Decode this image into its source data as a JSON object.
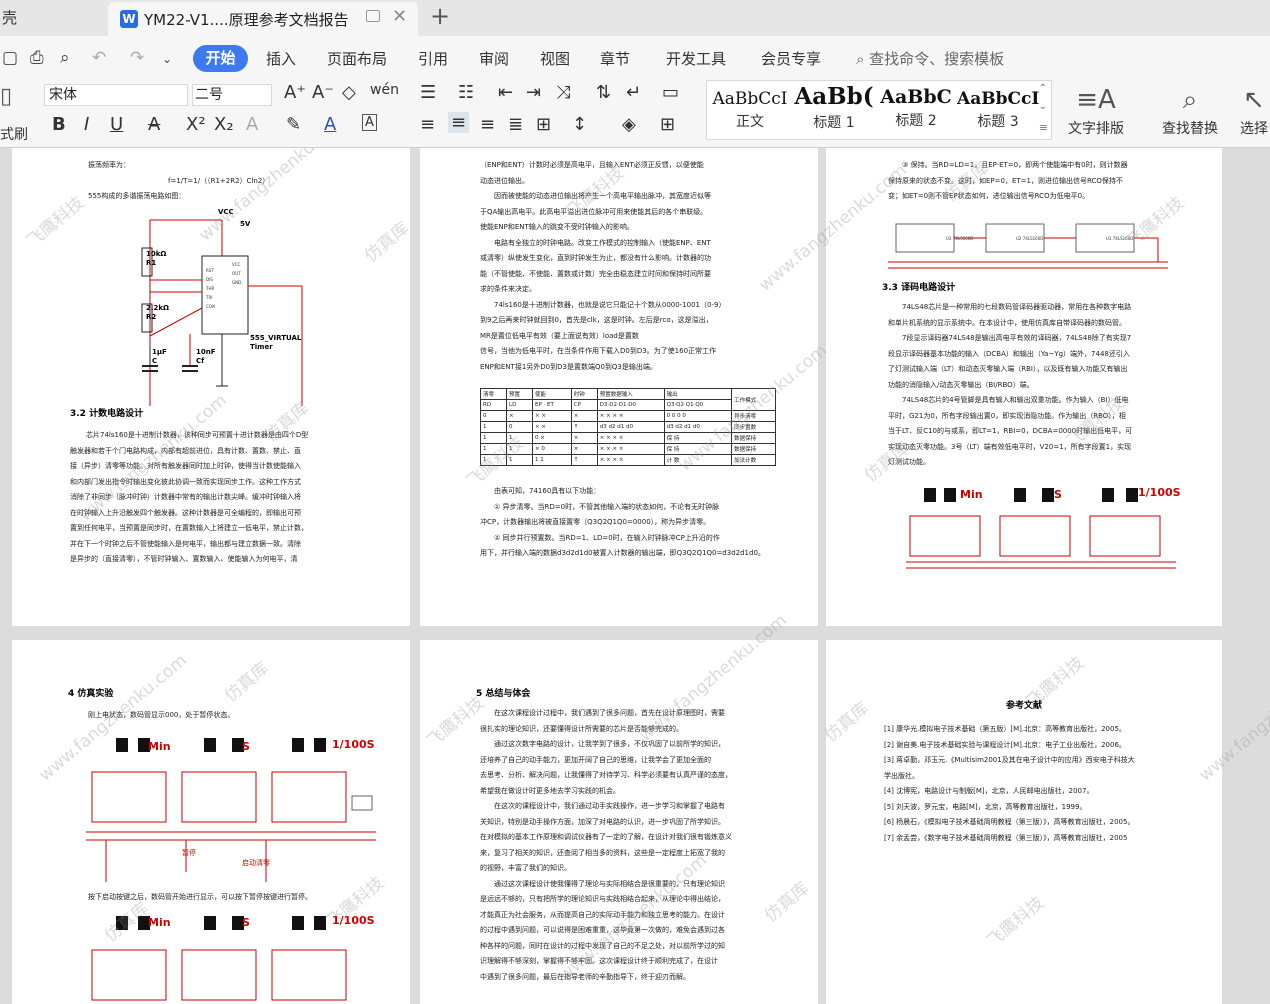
{
  "tabs": {
    "prev_label": "壳",
    "active_title": "YM22-V1....原理参考文档报告",
    "add": "+"
  },
  "menu": {
    "items": [
      "插入",
      "页面布局",
      "引用",
      "审阅",
      "视图",
      "章节",
      "开发工具",
      "会员专享"
    ],
    "active": "开始",
    "search_placeholder": "查找命令、搜索模板"
  },
  "toolbar": {
    "paste_label": "式刷",
    "font_name": "宋体",
    "font_size": "二号",
    "styles": [
      {
        "sample": "AaBbCcI",
        "name": "正文"
      },
      {
        "sample": "AaBb(",
        "name": "标题 1"
      },
      {
        "sample": "AaBbC",
        "name": "标题 2"
      },
      {
        "sample": "AaBbCcI",
        "name": "标题 3"
      }
    ],
    "text_layout": "文字排版",
    "find_replace": "查找替换",
    "select": "选择"
  },
  "page1": {
    "lines_top": [
      "振荡频率为：",
      "f=1/T=1/（（R1+2R2）Cln2）",
      "555构成的多谐振荡电路如图："
    ],
    "circuit": {
      "vcc": "VCC",
      "v5": "5V",
      "r1": "10kΩ",
      "r1n": "R1",
      "r2": "2.2kΩ",
      "r2n": "R2",
      "c": "1μF",
      "cn": "C",
      "cf": "10nF",
      "cfn": "Cf",
      "timer": "555_VIRTUAL",
      "timer2": "Timer",
      "pins": [
        "RST",
        "DIS",
        "THR",
        "TRI",
        "CON",
        "VCC",
        "OUT",
        "GND"
      ]
    },
    "heading": "3.2  计数电路设计",
    "body": [
      "芯片74ls160是十进制计数器，该种同步可预置十进计数器是由四个D型",
      "触发器和若干个门电路构成，内部有超前进位，具有计数、置数、禁止、直",
      "接（异步）清零等功能。对所有触发器同时加上时钟，使得当计数使能输入",
      "和内部门发出指令时输出变化彼此协调一致而实现同步工作。这种工作方式",
      "消除了非同步（脉冲时钟）计数器中常有的输出计数尖峰。缓冲时钟输入将",
      "在时钟输入上升沿触发四个触发器。这种计数器是可全编程的，即输出可预",
      "置到任何电平，当预置是同步时，在置数输入上将建立一低电平，禁止计数，",
      "并在下一个时钟之后不管使能输入是何电平，输出都与建立数据一致。清除",
      "是异步的（直接清零），不管时钟输入、置数输入、使能输入为何电平，清"
    ]
  },
  "page2": {
    "body": [
      "（ENP和ENT）计数时必须是高电平，且输入ENT必须正反馈，以便使能",
      "动态进位输出。",
      "因而被使能的动态进位输出将产生一个高电平输出脉冲，其宽度近似等",
      "于QA输出高电平。此高电平溢出进位脉冲可用来使能其后的各个串联级。",
      "使能ENP和ENT输入的跳变不受时钟输入的影响。",
      "电路有全独立的时钟电路。改变工作模式的控制输入（使能ENP、ENT",
      "或清零）纵使发生变化，直到时钟发生为止，都没有什么影响。计数器的功",
      "能（不管使能、不使能、置数或计数）完全由稳态建立时间和保持时间所要",
      "求的条件来决定。",
      "74ls160是十进制计数器，也就是说它只能记十个数从0000-1001（0-9）",
      "到9之后再来时钟就回到0，首先是clk，这是时钟。左后是rco，这是溢出，",
      "MR是置位低电平有效（要上面说有效）load是置数",
      "信号，当他为低电平时，在当条件作用下载入D0到D3。为了使160正常工作",
      "ENP和ENT接1另外D0到D3是置数端Q0到Q3是输出端。"
    ],
    "table_head": [
      "清零",
      "预置",
      "使能",
      "时钟",
      "预置数据输入",
      "输出",
      "工作模式"
    ],
    "table_sub": [
      "RD",
      "LD",
      "EP · ET",
      "CP",
      "D3·D2·D1·D0",
      "Q3·Q2·Q1·Q0",
      ""
    ],
    "table_rows": [
      [
        "0",
        "×",
        "× ×",
        "×",
        "× × × ×",
        "0 0 0 0",
        "异步清零"
      ],
      [
        "1",
        "0",
        "× ×",
        "↑",
        "d3 d2 d1 d0",
        "d3 d2 d1 d0",
        "同步置数"
      ],
      [
        "1",
        "1",
        "0 ×",
        "×",
        "× × × ×",
        "保 持",
        "数据保持"
      ],
      [
        "1",
        "1",
        "× 0",
        "×",
        "× × × ×",
        "保 持",
        "数据保持"
      ],
      [
        "1",
        "1",
        "1 1",
        "↑",
        "× × × ×",
        "计 数",
        "加法计数"
      ]
    ],
    "after": [
      "由表可知，74160具有以下功能：",
      "① 异步清零。当RD=0时，不管其他输入端的状态如何，不论有无时钟脉",
      "冲CP，计数器输出将被直接置零（Q3Q2Q1Q0=0000），称为异步清零。",
      "② 同步并行预置数。当RD=1、LD=0时，在输入时钟脉冲CP上升沿的作",
      "用下，并行输入端的数据d3d2d1d0被置入计数器的输出端，即Q3Q2Q1Q0=d3d2d1d0。"
    ]
  },
  "page3": {
    "top": [
      "③ 保持。当RD=LD=1，且EP·ET=0，即两个使能端中有0时，则计数器",
      "保持原来的状态不变。这时，如EP=0，ET=1，则进位输出信号RCO保持不",
      "变；如ET=0则不管EP状态如何，进位输出信号RCO为低电平0。"
    ],
    "chips": [
      "U3 74LS160D",
      "U2 74LS160D",
      "U1 74LS160D"
    ],
    "heading": "3.3  译码电路设计",
    "body": [
      "74LS48芯片是一种常用的七段数码管译码器驱动器，常用在各种数字电路",
      "和单片机系统的显示系统中。在本设计中，使用仿真库自带译码器的数码管。",
      "7段显示译码器74LS48是输出高电平有效的译码器，74LS48除了有实现7",
      "段显示译码器基本功能的输入（DCBA）和输出（Ya~Yg）端外，7448还引入",
      "了灯测试输入端（LT）和动态灭零输入端（RBI），以及既有输入功能又有输出",
      "功能的消隐输入/动态灭零输出（BI/RBO）端。",
      "74LS48芯片的4号管脚是具有输入和输出双重功能。作为输入（BI）低电",
      "平时，G21为0，所有字段输出置0，即实现消隐功能。作为输出（RBO），相",
      "当于LT、反C10的与或系，即LT=1，RBI=0，DCBA=0000时输出低电平，可",
      "实现动态灭零功能。3号（LT）端有效低电平时，V20=1，所有字段置1，实现",
      "灯测试功能。"
    ],
    "labels": [
      "Min",
      "S",
      "1/100S"
    ]
  },
  "page4": {
    "heading": "4  仿真实验",
    "line1": "刚上电状态，数码管显示000，处于暂停状态。",
    "line2": "按下启动按键之后，数码管开始进行显示，可以按下暂停按键进行暂停。",
    "labels": [
      "Min",
      "S",
      "1/100S"
    ],
    "sub_labels": [
      "暂停",
      "启动清零"
    ]
  },
  "page5": {
    "heading": "5  总结与体会",
    "body": [
      "在这次课程设计过程中，我们遇到了很多问题，首先在设计原理图时，需要",
      "很扎实的理论知识，还要懂得设计所需要的芯片是否能够完成的。",
      "通过这次数字电路的设计，让我学到了很多，不仅巩固了以前所学的知识，",
      "还培养了自己的动手能力，更加开阔了自己的思维，让我学会了更加全面的",
      "去思考、分析、解决问题，让我懂得了对待学习、科学必须要有认真严谨的态度，",
      "希望我在做设计时更多地去学习实践的机会。",
      "在这次的课程设计中，我们通过动手实践操作，进一步学习和掌握了电路有",
      "关知识，特别是动手操作方面，加深了对电路的认识，进一步巩固了所学知识。",
      "在对模拟的基本工作原理和调试仪器有了一定的了解，在设计对我们很有锻炼意义",
      "来，复习了相关的知识，还查阅了相当多的资料，这些是一定程度上拓宽了我的",
      "的视野，丰富了我们的知识。",
      "通过这次课程设计使我懂得了理论与实际相结合是很重要的，只有理论知识",
      "是远远不够的，只有把所学的理论知识与实践相结合起来，从理论中得出结论，",
      "才能真正为社会服务，从而提高自己的实际动手能力和独立思考的能力。在设计",
      "的过程中遇到问题，可以说得是困难重重，这毕竟第一次做的，难免会遇到过各",
      "种各样的问题，同时在设计的过程中发现了自己的不足之处，对以前所学过的知",
      "识理解得不够深刻，掌握得不够牢固。这次课程设计终于顺利完成了，在设计",
      "中遇到了很多问题，最后在指导老师的辛勤指导下，终于迎刃而解。"
    ]
  },
  "page6": {
    "title": "参考文献",
    "refs": [
      "[1] 康华光.模拟电子技术基础（第五版）[M].北京：高等教育出版社，2005。",
      "[2] 谢自美.电子技术基础实验与课程设计[M].北京：电子工业出版社，2006。",
      "[3] 蒋卓勤，邓玉元.《Multisim2001及其在电子设计中的应用》西安电子科技大",
      "学出版社。",
      "[4] 沈博宪，电路设计与制版[M]，北京，人民邮电出版社，2007。",
      "[5] 刘天波，罗元宝，电路[M]，北京，高等教育出版社，1999。",
      "[6] 杨晨石，《模拟电子技术基础简明教程（第三版）》，高等教育出版社，2005。",
      "[7] 余孟尝，《数字电子技术基础简明教程（第三版）》，高等教育出版社，2005"
    ]
  },
  "watermarks": [
    "飞鹰科技",
    "www.fangzhenku.com",
    "仿真库"
  ]
}
